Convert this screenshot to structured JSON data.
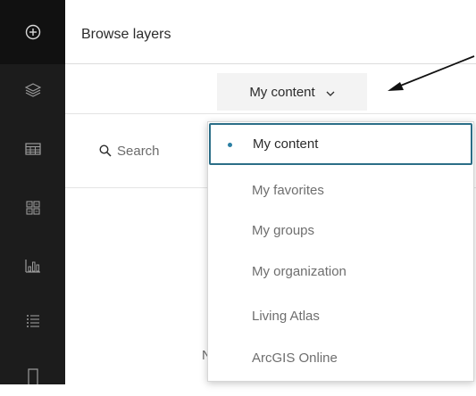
{
  "header": {
    "title": "Browse layers"
  },
  "toolbar": {
    "source_label": "My content"
  },
  "search": {
    "placeholder": "Search"
  },
  "background": {
    "partial_text": "N"
  },
  "source_menu": {
    "selected": "My content",
    "items": [
      {
        "label": "My content"
      },
      {
        "label": "My favorites"
      },
      {
        "label": "My groups"
      },
      {
        "label": "My organization"
      },
      {
        "label": "Living Atlas"
      },
      {
        "label": "ArcGIS Online"
      }
    ]
  },
  "rail": {
    "items": [
      {
        "icon": "add-icon"
      },
      {
        "icon": "layers-icon"
      },
      {
        "icon": "table-icon"
      },
      {
        "icon": "widgets-icon"
      },
      {
        "icon": "bar-chart-icon"
      },
      {
        "icon": "legend-list-icon"
      },
      {
        "icon": "bookmark-icon"
      }
    ]
  },
  "colors": {
    "rail_bg": "#1c1c1c",
    "rail_top_bg": "#111111",
    "selected_border": "#2b6e87",
    "selected_dot": "#2b7fa3"
  }
}
